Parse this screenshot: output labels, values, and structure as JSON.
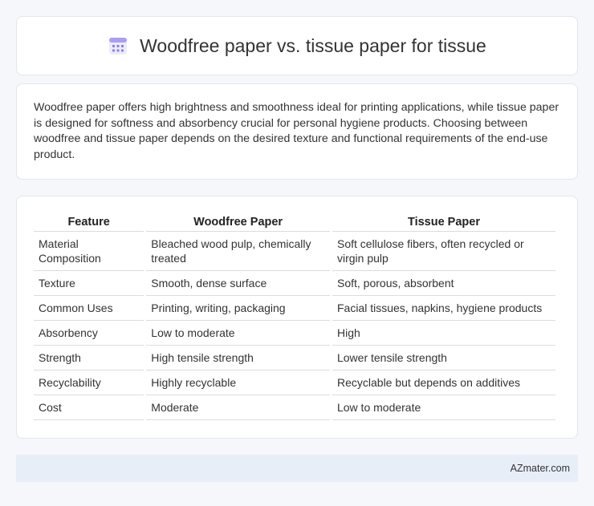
{
  "header": {
    "title": "Woodfree paper vs. tissue paper for tissue",
    "icon": "calendar-icon"
  },
  "intro": {
    "text": "Woodfree paper offers high brightness and smoothness ideal for printing applications, while tissue paper is designed for softness and absorbency crucial for personal hygiene products. Choosing between woodfree and tissue paper depends on the desired texture and functional requirements of the end-use product."
  },
  "table": {
    "headers": [
      "Feature",
      "Woodfree Paper",
      "Tissue Paper"
    ],
    "rows": [
      [
        "Material Composition",
        "Bleached wood pulp, chemically treated",
        "Soft cellulose fibers, often recycled or virgin pulp"
      ],
      [
        "Texture",
        "Smooth, dense surface",
        "Soft, porous, absorbent"
      ],
      [
        "Common Uses",
        "Printing, writing, packaging",
        "Facial tissues, napkins, hygiene products"
      ],
      [
        "Absorbency",
        "Low to moderate",
        "High"
      ],
      [
        "Strength",
        "High tensile strength",
        "Lower tensile strength"
      ],
      [
        "Recyclability",
        "Highly recyclable",
        "Recyclable but depends on additives"
      ],
      [
        "Cost",
        "Moderate",
        "Low to moderate"
      ]
    ]
  },
  "footer": {
    "brand": "AZmater.com"
  },
  "colors": {
    "background": "#f5f7fb",
    "card": "#ffffff",
    "footer_bg": "#e8eef8",
    "icon_accent": "#8b7fe6"
  }
}
